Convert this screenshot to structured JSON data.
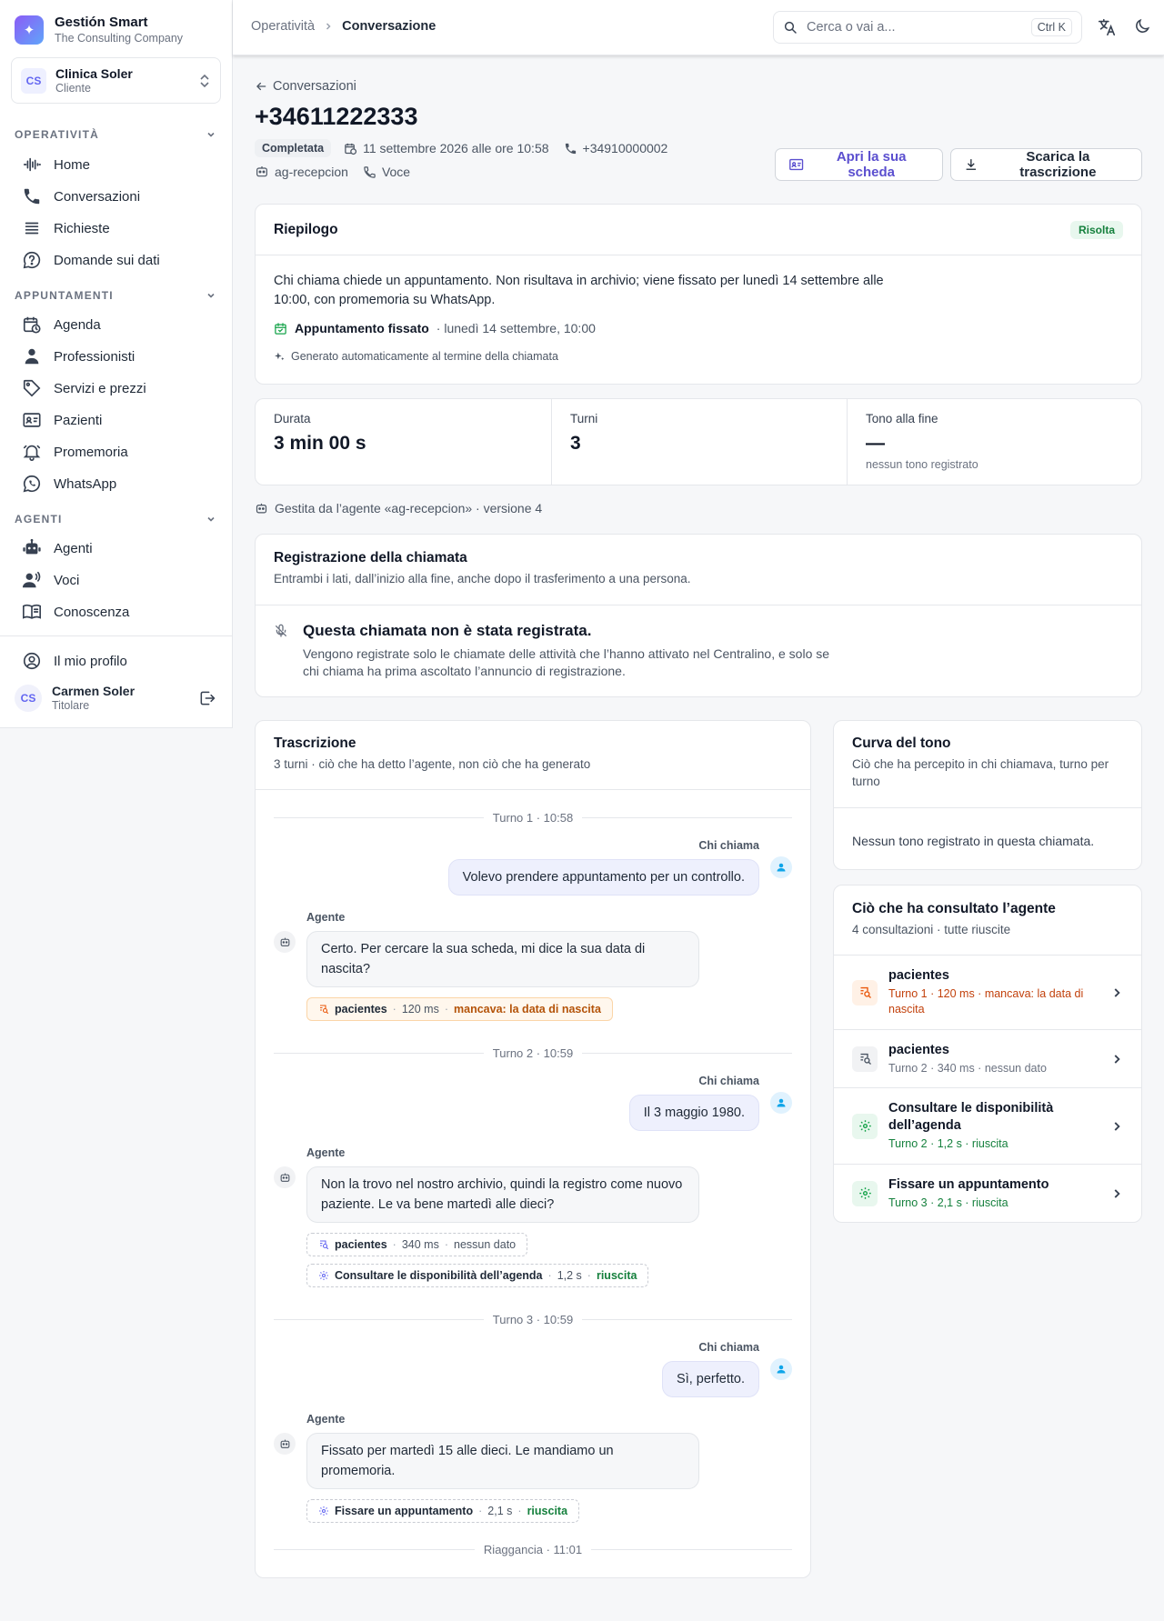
{
  "brand": {
    "name": "Gestión Smart",
    "subtitle": "The Consulting Company"
  },
  "org": {
    "initials": "CS",
    "name": "Clinica Soler",
    "role": "Cliente"
  },
  "nav": {
    "sections": [
      {
        "title": "OPERATIVITÀ",
        "items": [
          "Home",
          "Conversazioni",
          "Richieste",
          "Domande sui dati"
        ]
      },
      {
        "title": "APPUNTAMENTI",
        "items": [
          "Agenda",
          "Professionisti",
          "Servizi e prezzi",
          "Pazienti",
          "Promemoria",
          "WhatsApp"
        ]
      },
      {
        "title": "AGENTI",
        "items": [
          "Agenti",
          "Voci",
          "Conoscenza"
        ]
      }
    ],
    "profile_link": "Il mio profilo"
  },
  "user": {
    "initials": "CS",
    "name": "Carmen Soler",
    "role": "Titolare"
  },
  "topbar": {
    "breadcrumb": [
      "Operatività",
      "Conversazione"
    ],
    "search_placeholder": "Cerca o vai a...",
    "shortcut": "Ctrl K"
  },
  "conversation": {
    "back_label": "Conversazioni",
    "phone": "+34611222333",
    "status": "Completata",
    "datetime": "11 settembre 2026 alle ore 10:58",
    "line_number": "+34910000002",
    "agent": "ag-recepcion",
    "channel": "Voce",
    "open_record_label": "Apri la sua scheda",
    "download_label": "Scarica la trascrizione"
  },
  "summary": {
    "title": "Riepilogo",
    "badge": "Risolta",
    "text": "Chi chiama chiede un appuntamento. Non risultava in archivio; viene fissato per lunedì 14 settembre alle 10:00, con promemoria su WhatsApp.",
    "appointment_label": "Appuntamento fissato",
    "appointment_detail": "· lunedì 14 settembre, 10:00",
    "generated_note": "Generato automaticamente al termine della chiamata"
  },
  "stats": [
    {
      "label": "Durata",
      "value": "3 min 00 s",
      "foot": ""
    },
    {
      "label": "Turni",
      "value": "3",
      "foot": ""
    },
    {
      "label": "Tono alla fine",
      "value": "—",
      "foot": "nessun tono registrato"
    }
  ],
  "handled_by": "Gestita da l’agente «ag-recepcion» · versione 4",
  "recording": {
    "title": "Registrazione della chiamata",
    "subtitle": "Entrambi i lati, dall’inizio alla fine, anche dopo il trasferimento a una persona.",
    "empty_title": "Questa chiamata non è stata registrata.",
    "empty_text": "Vengono registrate solo le chiamate delle attività che l’hanno attivato nel Centralino, e solo se chi chiama ha prima ascoltato l’annuncio di registrazione."
  },
  "transcript": {
    "title": "Trascrizione",
    "subtitle": "3 turni · ciò che ha detto l’agente, non ciò che ha generato",
    "caller_label": "Chi chiama",
    "agent_label": "Agente",
    "turns": [
      {
        "label": "Turno 1 · 10:58",
        "caller": "Volevo prendere appuntamento per un controllo.",
        "agent": "Certo. Per cercare la sua scheda, mi dice la sua data di nascita?",
        "tools": [
          {
            "name": "pacientes",
            "time": "120 ms",
            "result": "mancava: la data di nascita"
          }
        ]
      },
      {
        "label": "Turno 2 · 10:59",
        "caller": "Il 3 maggio 1980.",
        "agent": "Non la trovo nel nostro archivio, quindi la registro come nuovo paziente. Le va bene martedì alle dieci?",
        "tools": [
          {
            "name": "pacientes",
            "time": "340 ms",
            "result": "nessun dato"
          },
          {
            "name": "Consultare le disponibilità dell’agenda",
            "time": "1,2 s",
            "result": "riuscita"
          }
        ]
      },
      {
        "label": "Turno 3 · 10:59",
        "caller": "Sì, perfetto.",
        "agent": "Fissato per martedì 15 alle dieci. Le mandiamo un promemoria.",
        "tools": [
          {
            "name": "Fissare un appuntamento",
            "time": "2,1 s",
            "result": "riuscita"
          }
        ]
      }
    ],
    "hangup": "Riaggancia · 11:01"
  },
  "tone_curve": {
    "title": "Curva del tono",
    "subtitle": "Ciò che ha percepito in chi chiamava, turno per turno",
    "empty": "Nessun tono registrato in questa chiamata."
  },
  "consultations": {
    "title": "Ciò che ha consultato l’agente",
    "subtitle": "4 consultazioni · tutte riuscite",
    "items": [
      {
        "name": "pacientes",
        "detail": "Turno 1 · 120 ms · mancava: la data di nascita"
      },
      {
        "name": "pacientes",
        "detail": "Turno 2 · 340 ms · nessun dato"
      },
      {
        "name": "Consultare le disponibilità dell’agenda",
        "detail": "Turno 2 · 1,2 s · riuscita"
      },
      {
        "name": "Fissare un appuntamento",
        "detail": "Turno 3 · 2,1 s · riuscita"
      }
    ]
  },
  "colors": {
    "accent": "#6366f1",
    "success": "#15803d",
    "warning": "#b45309"
  }
}
